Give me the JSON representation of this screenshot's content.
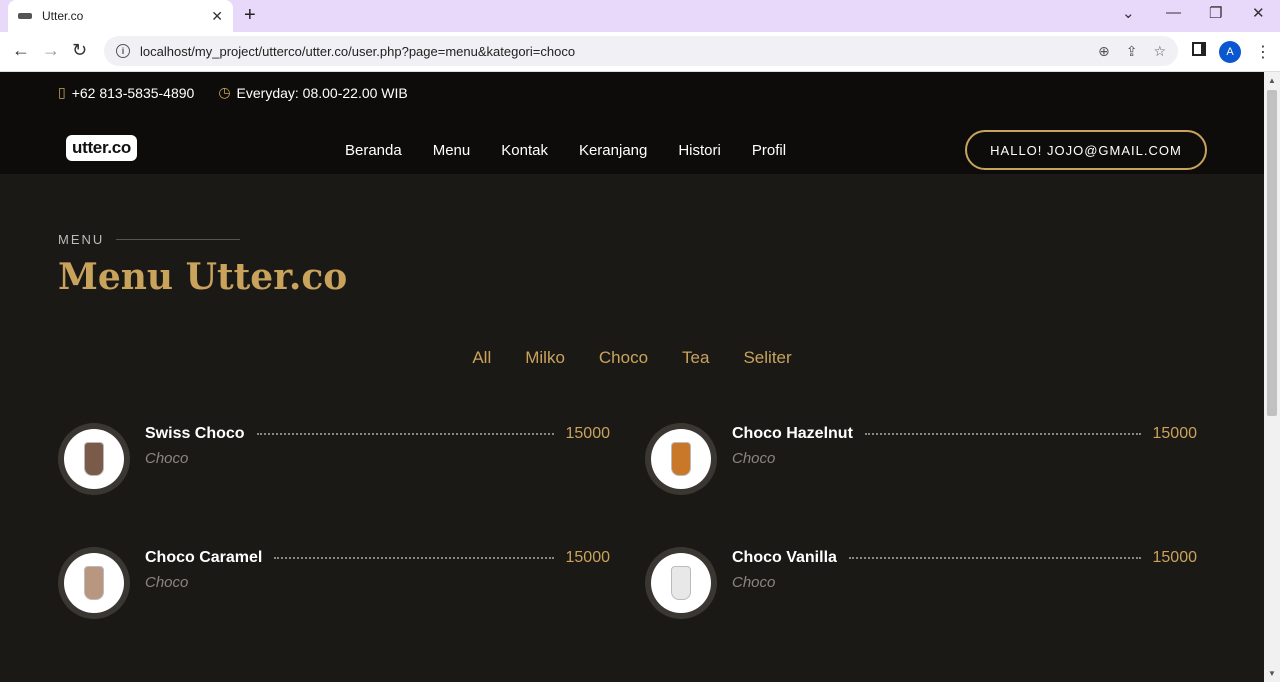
{
  "browser": {
    "tab_title": "Utter.co",
    "url": "localhost/my_project/utterco/utter.co/user.php?page=menu&kategori=choco",
    "avatar_letter": "A"
  },
  "topbar": {
    "phone": "+62 813-5835-4890",
    "hours": "Everyday: 08.00-22.00 WIB"
  },
  "logo": "utter.co",
  "nav": [
    "Beranda",
    "Menu",
    "Kontak",
    "Keranjang",
    "Histori",
    "Profil"
  ],
  "user_button": "HALLO! JOJO@GMAIL.COM",
  "section": {
    "label": "MENU",
    "title": "Menu Utter.co"
  },
  "filters": [
    "All",
    "Milko",
    "Choco",
    "Tea",
    "Seliter"
  ],
  "items": [
    {
      "name": "Swiss Choco",
      "category": "Choco",
      "price": "15000",
      "cup_color": "#7a5a48"
    },
    {
      "name": "Choco Hazelnut",
      "category": "Choco",
      "price": "15000",
      "cup_color": "#c9782a"
    },
    {
      "name": "Choco Caramel",
      "category": "Choco",
      "price": "15000",
      "cup_color": "#b89680"
    },
    {
      "name": "Choco Vanilla",
      "category": "Choco",
      "price": "15000",
      "cup_color": "#e8e8e8"
    }
  ]
}
